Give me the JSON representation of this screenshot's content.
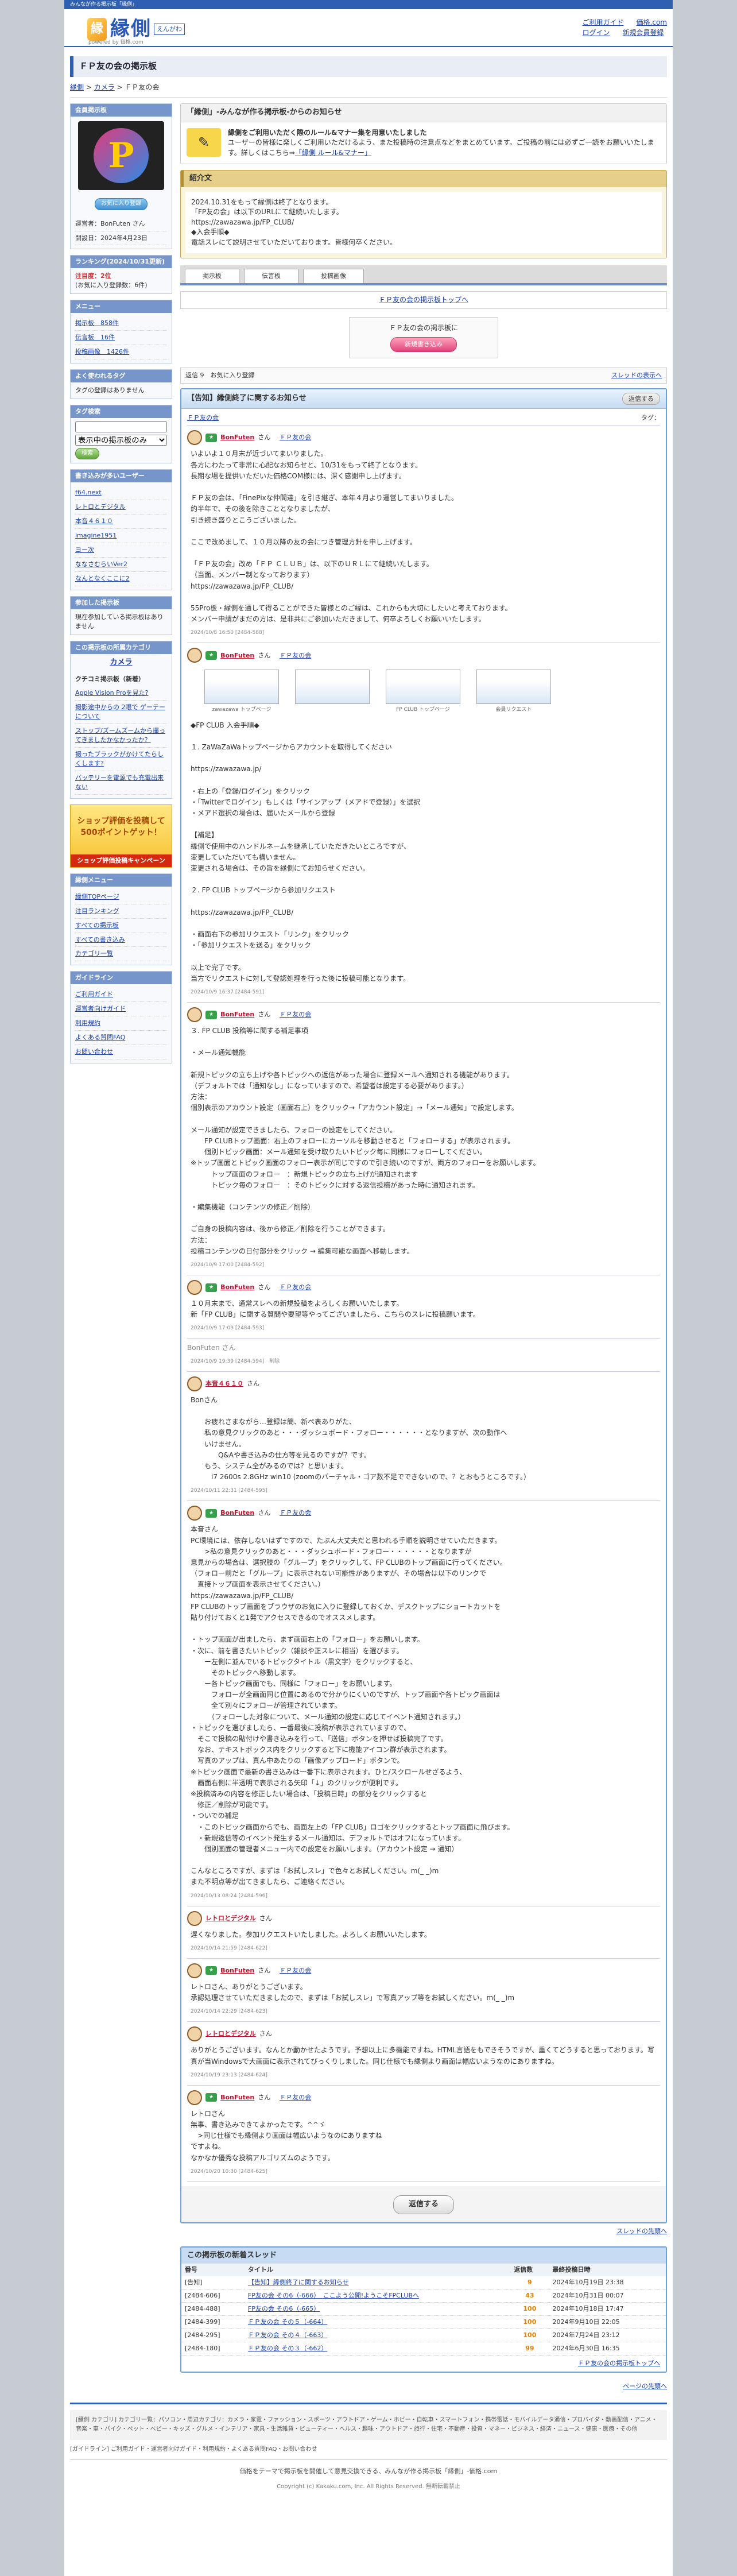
{
  "topbar": "みんなが作る掲示板「縁側」",
  "logo": {
    "name": "縁側",
    "sub": "えんがわ",
    "powered": "powered by 価格.com"
  },
  "hnav": {
    "guide": "ご利用ガイド",
    "kakaku": "価格.com",
    "login": "ログイン",
    "register": "新規会員登録"
  },
  "page_title": "ＦＰ友の会の掲示板",
  "breadcrumb": {
    "home": "縁側",
    "cat": "カメラ",
    "current": "ＦＰ友の会"
  },
  "side": {
    "owner_h": "会員掲示板",
    "fav_btn": "お気に入り登録",
    "admin": "運営者：BonFuten さん",
    "created": "開設日：2024年4月23日",
    "rank_h": "ランキング(2024/10/31更新)",
    "rank_v": "注目度：2位",
    "rank_note": "(お気に入り登録数：6件)",
    "menu_h": "メニュー",
    "menu": [
      "掲示板　858件",
      "伝言板　16件",
      "投稿画像　1426件"
    ],
    "words_h": "よく使われるタグ",
    "words_note": "タグの登録はありません",
    "tag_h": "タグ検索",
    "tag_select": "表示中の掲示板のみ",
    "tag_btn": "検索",
    "users_h": "書き込みが多いユーザー",
    "users": [
      "f64.next",
      "レトロとデジタル",
      "本音４６１０",
      "imagine1951",
      "ヨー次",
      "ななさむらいVer2",
      "なんとなくここに2"
    ],
    "same_h": "参加した掲示板",
    "same_note": "現在参加している掲示板はありません",
    "catlink_h": "この掲示板の所属カテゴリ",
    "catlink": "カメラ",
    "qa_h": "クチコミ掲示板（新着）",
    "qa": [
      "Apple Vision Proを見た?",
      "撮影途中からの 2眼で ゲーテーについて",
      "ストップ/ズームズームから撮ってきましたかなかったか？",
      "撮ったブラックがかけてたらしくします?",
      "バッテリーを電源でも充電出来ない"
    ],
    "ad_text": "ショップ評価を投稿して 500ポイントゲット！",
    "ad_bottom": "ショップ評価投稿キャンペーン",
    "engawa_h": "縁側メニュー",
    "engawa": [
      "縁側TOPページ",
      "注目ランキング",
      "すべての掲示板",
      "すべての書き込み",
      "カテゴリ一覧"
    ],
    "guide_h": "ガイドライン",
    "guide": [
      "ご利用ガイド",
      "運営者向けガイド",
      "利用規約",
      "よくある質問FAQ",
      "お問い合わせ"
    ]
  },
  "notice": {
    "title": "「縁側」-みんなが作る掲示板-からのお知らせ",
    "bold": "縁側をご利用いただく際のルール&マナー集を用意いたしました",
    "text": "ユーザーの皆様に楽しくご利用いただけるよう、また投稿時の注意点などをまとめています。ご投稿の前には必ずご一読をお願いいたします。詳しくはこちら⇒",
    "link": "「縁側 ルール&マナー」"
  },
  "intro": {
    "title": "紹介文",
    "text": "2024.10.31をもって縁側は終了となります。\n「FP友の会」は以下のURLにて継続いたします。\nhttps://zawazawa.jp/FP_CLUB/\n◆入会手順◆\n電話スレにて説明させていただいております。皆様何卒ください。"
  },
  "tabs": [
    "掲示板",
    "伝言板",
    "投稿画像"
  ],
  "topbar_link": "ＦＰ友の会の掲示板トップへ",
  "postbox": {
    "text": "ＦＰ友の会の掲示板に",
    "btn": "新規書き込み"
  },
  "tools": {
    "left": "返信 9　お気に入り登録",
    "right": "スレッドの表示へ"
  },
  "thread": {
    "title": "【告知】縁側終了に関するお知らせ",
    "btn": "返信する",
    "tag": "タグ：",
    "board": "ＦＰ友の会"
  },
  "posts": [
    {
      "name": "BonFuten",
      "san": "さん",
      "board": "ＦＰ友の会",
      "body": "いよいよ１０月末が近づいてまいりました。\n各方にわたって非常に心配なお知らせと、10/31をもって終了となります。\n長期な場を提供いただいた価格COM様には、深く感謝申し上げます。\n\nＦＰ友の会は、「FinePixな仲間達」を引き継ぎ、本年４月より運営してまいりました。\n約半年で、その後を除きこととなりましたが、\n引き続き盛りとこうございました。\n\nここで改めまして、１０月以降の友の会につき管理方針を申し上げます。\n\n「ＦＰ友の会」改め「ＦＰ ＣＬＵＢ」は、以下のＵＲＬにて継続いたします。\n（当面、メンバー制となっております）\nhttps://zawazawa.jp/FP_CLUB/\n\n55Pro板・縁側を通して得ることができた皆様とのご縁は、これからも大切にしたいと考えております。\nメンバー申請がまだの方は、是非共にご参加いただきまして、何卒よろしくお願いいたします。",
      "date": "2024/10/8 16:50",
      "sub": "[2484-588]"
    },
    {
      "name": "BonFuten",
      "san": "さん",
      "board": "ＦＰ友の会",
      "thumbs": [
        "zawazawa トップページ",
        "",
        "FP CLUB トップページ",
        "会員リクエスト"
      ],
      "body": "◆FP CLUB 入会手順◆\n\n１. ZaWaZaWaトップページからアカウントを取得してください\n\nhttps://zawazawa.jp/\n\n・右上の「登録/ログイン」をクリック\n・「Twitterでログイン」もしくは「サインアップ（メアドで登録）」を選択\n・メアド選択の場合は、届いたメールから登録\n\n【補足】\n縁側で使用中のハンドルネームを継承していただきたいところですが、\n変更していただいても構いません。\n変更される場合は、その旨を縁側にてお知らせください。\n\n２. FP CLUB トップページから参加リクエスト\n\nhttps://zawazawa.jp/FP_CLUB/\n\n・画面右下の参加リクエスト「リンク」をクリック\n・「参加リクエストを送る」をクリック\n\n以上で完了です。\n当方でリクエストに対して登認処理を行った後に投稿可能となります。",
      "date": "2024/10/9 16:37",
      "sub": "[2484-591]"
    },
    {
      "name": "BonFuten",
      "san": "さん",
      "board": "ＦＰ友の会",
      "body": "３. FP CLUB 投稿等に関する補足事項\n\n・メール通知機能\n\n新規トピックの立ち上げや各トピックへの返信があった場合に登録メールへ通知される機能があります。\n（デフォルトでは「通知なし」になっていますので、希望者は設定する必要があります。）\n方法：\n個別表示のアカウント設定（画面右上）をクリック→「アカウント設定」→「メール通知」で設定します。\n\nメール通知が設定できましたら、フォローの設定をしてください。\n　　FP CLUBトップ画面：右上のフォローにカーソルを移動させると「フォローする」が表示されます。\n　　個別トピック画面：メール通知を受け取りたいトピック毎に同様にフォローしてください。\n※トップ画面とトピック画面のフォロー表示が同じですので引き続いのですが、両方のフォローをお願いします。\n　　　トップ画面のフォロー　：新規トピックの立ち上げが通知されます\n　　　トピック毎のフォロー　：そのトピックに対する返信投稿があった時に通知されます。\n\n・編集機能（コンテンツの修正／削除）\n\nご自身の投稿内容は、後から修正／削除を行うことができます。\n方法：\n投稿コンテンツの日付部分をクリック → 編集可能な画面へ移動します。",
      "date": "2024/10/9 17:00",
      "sub": "[2484-592]"
    },
    {
      "name": "BonFuten",
      "san": "さん",
      "board": "ＦＰ友の会",
      "body": "１０月末まで、通常スレへの新規投稿をよろしくお願いいたします。\n新「FP CLUB」に関する質問や要望等やってございましたら、こちらのスレに投稿願います。",
      "date": "2024/10/9 17:09",
      "sub": "[2484-593]"
    },
    {
      "deleted": "BonFuten さん",
      "date": "2024/10/9 19:39",
      "sub": "[2484-594]　削除"
    },
    {
      "name": "本音４６１０",
      "san": "さん",
      "body": "Bonさん\n\n　　お疲れさまながら…登録は簡、新ぺ表ありがた、\n　　私の意見クリックのあと・・・ダッシュボード・フォロー・・・・・・となりますが、次の動作へ\n　　いけません。\n　　　　Q&Aや書き込みの仕方等を見るのですが？です。\n　　もう、システム全がみるのでは？と思います。\n　　　i7 2600s 2.8GHz win10 (zoomのバーチャル・ゴア数不足でできないので、？とおもうところです。）",
      "date": "2024/10/11 22:31",
      "sub": "[2484-595]"
    },
    {
      "name": "BonFuten",
      "san": "さん",
      "board": "ＦＰ友の会",
      "body": "本音さん\nPC環境には、依存しないはずですので、たぶん大丈夫だと思われる手順を説明させていただきます。\n　　>私の意見クリックのあと・・・ダッシュボード・フォロー・・・・・・となりますが\n意見からの場合は、選択肢の「グループ」をクリックして、FP CLUBのトップ画面に行ってください。\n（フォロー前だと「グループ」に表示されない可能性がありますが、その場合は以下のリンクで\n　直接トップ画面を表示させてください。）\nhttps://zawazawa.jp/FP_CLUB/\nFP CLUBのトップ画面をブラウザのお気に入りに登録しておくか、デスクトップにショートカットを\n貼り付けておくと1発でアクセスできるのでオススメします。\n\n・トップ画面が出ましたら、まず画面右上の「フォロー」をお願いします。\n・次に、前を書きたいトピック（雑談や正スレに相当）を選びます。\n　　ー左側に並んでいるトピックタイトル（黒文字）をクリックすると、\n　　　そのトピックへ移動します。\n　　ー各トピック画面でも、同様に「フォロー」をお願いします。\n　　　フォローが全画面同じ位置にあるので分かりにくいのですが、トップ画面や各トピック画面は\n　　　全て別々にフォローが管理されています。\n　　　（フォローした対象について、メール通知の設定に応じてイベント通知されます。）\n・トピックを選びましたら、一番最後に投稿が表示されていますので、\n　そこで投稿の貼付けや書き込みを行って、「送信」ボタンを押せば投稿完了です。\n　なお、テキストボックス内をクリックすると下に機能アイコン群が表示されます。\n　写真のアップは、真ん中あたりの「画像アップロード」ボタンで。\n※トピック画面で最新の書き込みは一番下に表示されます。ひと/スクロールせざるよう、\n　画面右側に半透明で表示される矢印「↓」のクリックが便利です。\n※投稿済みの内容を修正したい場合は、「投稿日時」の部分をクリックすると\n　修正／削除が可能です。\n・ついでの補足\n　・このトピック画面からでも、画面左上の「FP CLUB」ロゴをクリックするとトップ画面に飛びます。\n　・新規返信等のイベント発生するメール通知は、デフォルトではオフになっています。\n　　個別画面の管理者メニュー内での設定をお願いします。（アカウント設定 → 通知）\n\nこんなところですが、まずは「お試しスレ」で色々とお試しください。m(_ _)m\nまた不明点等が出てきましたら、ご連絡ください。",
      "date": "2024/10/13 08:24",
      "sub": "[2484-596]"
    },
    {
      "name": "レトロとデジタル",
      "san": "さん",
      "body": "遅くなりました。参加リクエストいたしました。よろしくお願いいたします。",
      "date": "2024/10/14 21:59",
      "sub": "[2484-622]"
    },
    {
      "name": "BonFuten",
      "san": "さん",
      "board": "ＦＰ友の会",
      "body": "レトロさん、ありがとうございます。\n承認処理させていただきましたので、まずは「お試しスレ」で写真アップ等をお試しください。m(_ _)m",
      "date": "2024/10/14 22:29",
      "sub": "[2484-623]"
    },
    {
      "name": "レトロとデジタル",
      "san": "さん",
      "body": "ありがとうございます。なんとか動かせたようです。予想以上に多機能ですね。HTML言語をもできそうですが、重くてどうすると思っております。写真が当Windowsで大画面に表示されてびっくりしました。同じ仕様でも縁側より画面は幅広いようなのにありますね。",
      "date": "2024/10/19 23:13",
      "sub": "[2484-624]"
    },
    {
      "name": "BonFuten",
      "san": "さん",
      "board": "ＦＰ友の会",
      "body": "レトロさん\n無事、書き込みできてよかったです。^^ゞ\n　>同じ仕様でも縁側より画面は幅広いようなのにありますね\nですよね。\nなかなか優秀な投稿アルゴリズムのようです。",
      "date": "2024/10/20 10:30",
      "sub": "[2484-625]"
    }
  ],
  "reply_btn": "返信する",
  "thread_top": "スレッドの先頭へ",
  "same": {
    "title": "この掲示板の新着スレッド",
    "heads": [
      "番号",
      "タイトル",
      "返信数",
      "最終投稿日時"
    ],
    "rows": [
      [
        "[告知]",
        "【告知】縁側終了に関するお知らせ",
        "9",
        "2024年10月19日 23:38"
      ],
      [
        "[2484-606]",
        "FP友の会 その6（-666）　ここよう公開!ようこそFPCLUBへ",
        "43",
        "2024年10月31日 00:07"
      ],
      [
        "[2484-488]",
        "FP友の会 その6（-665）",
        "100",
        "2024年10月18日 17:47"
      ],
      [
        "[2484-399]",
        "ＦＰ友の会 その５（-664）",
        "100",
        "2024年9月10日 22:05"
      ],
      [
        "[2484-295]",
        "ＦＰ友の会 その４（-663）",
        "100",
        "2024年7月24日 23:12"
      ],
      [
        "[2484-180]",
        "ＦＰ友の会 その３（-662）",
        "99",
        "2024年6月30日 16:35"
      ]
    ]
  },
  "board_top": "ＦＰ友の会の掲示板トップへ",
  "page_top": "ページの先頭へ",
  "footer": {
    "cats": "[縁側 カテゴリ] カテゴリ一覧：パソコン・周辺カテゴリ：カメラ・家電・ファッション・スポーツ・アウトドア・ゲーム・ホビー・自転車・スマートフォン・携帯電話・モバイルデータ通信・プロバイダ・動画配信・アニメ・音楽・車・バイク・ペット・ベビー・キッズ・グルメ・インテリア・家具・生活雑貨・ビューティー・ヘルス・趣味・アウトドア・旅行・住宅・不動産・投資・マネー・ビジネス・経済・ニュース・健康・医療・その他",
    "guide": "[ガイドライン] ご利用ガイド・運営者向けガイド・利用規約・よくある質問FAQ・お問い合わせ",
    "note": "価格をテーマで掲示板を開催して意見交換できる、みんなが作る掲示板「縁側」-価格.com",
    "copy": "Copyright (c) Kakaku.com, Inc. All Rights Reserved. 無断転載禁止"
  }
}
